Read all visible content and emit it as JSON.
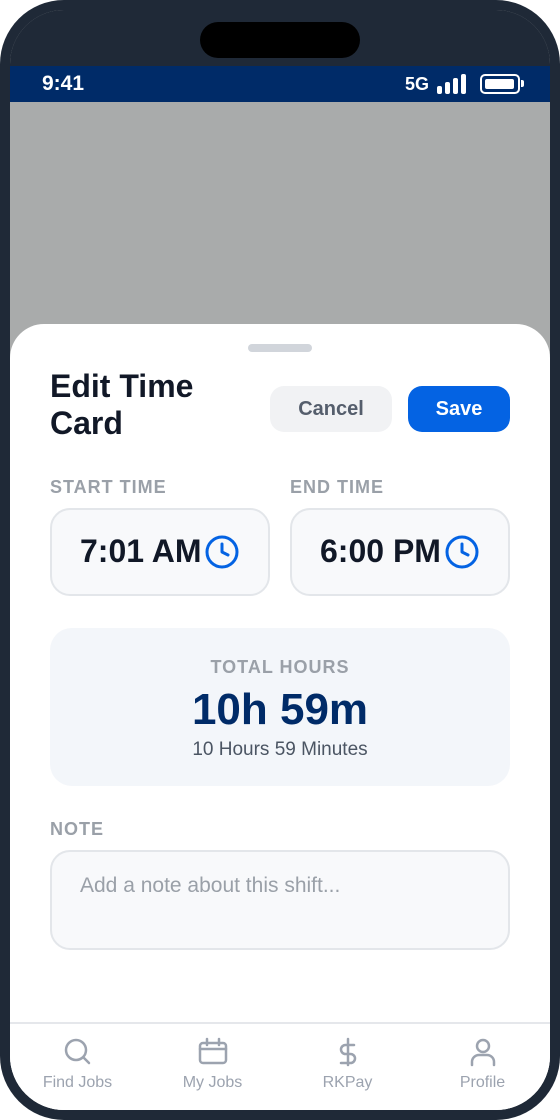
{
  "status_bar": {
    "time": "9:41",
    "network": "5G",
    "battery_level": 1.0
  },
  "sheet": {
    "title": "Edit Time Card",
    "cancel_label": "Cancel",
    "save_label": "Save"
  },
  "start_time": {
    "label": "START TIME",
    "value": "7:01 AM",
    "icon": "clock-icon"
  },
  "end_time": {
    "label": "END TIME",
    "value": "6:00 PM",
    "icon": "clock-icon"
  },
  "total": {
    "label": "TOTAL HOURS",
    "value": "10h 59m",
    "subtext": "10 Hours 59 Minutes"
  },
  "note": {
    "label": "NOTE",
    "value": "",
    "placeholder": "Add a note about this shift..."
  },
  "tabbar": {
    "items": [
      {
        "label": "Find Jobs",
        "icon": "search-icon"
      },
      {
        "label": "My Jobs",
        "icon": "calendar-icon"
      },
      {
        "label": "RKPay",
        "icon": "dollar-icon"
      },
      {
        "label": "Profile",
        "icon": "person-icon"
      }
    ]
  },
  "colors": {
    "primary": "#0463e3",
    "navy": "#002b68",
    "muted": "#9aa0a8",
    "backdrop": "#a9abab"
  }
}
